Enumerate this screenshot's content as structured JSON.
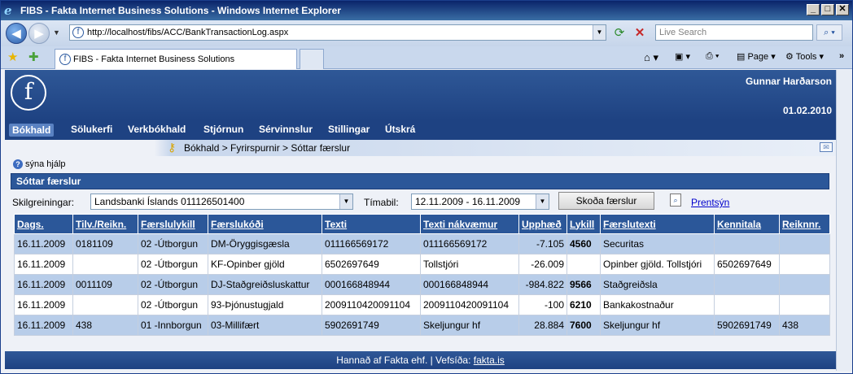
{
  "window": {
    "title": "FIBS - Fakta Internet Business Solutions - Windows Internet Explorer",
    "min_label": "_",
    "max_label": "□",
    "close_label": "✕"
  },
  "address_bar": {
    "url": "http://localhost/fibs/ACC/BankTransactionLog.aspx",
    "search_placeholder": "Live Search"
  },
  "tab": {
    "label": "FIBS - Fakta Internet Business Solutions"
  },
  "toolbar": {
    "page_label": "Page",
    "tools_label": "Tools"
  },
  "header": {
    "logo_letter": "f",
    "user": "Gunnar Harðarson",
    "date": "01.02.2010"
  },
  "menu": {
    "items": [
      {
        "label": "Bókhald"
      },
      {
        "label": "Sölukerfi"
      },
      {
        "label": "Verkbókhald"
      },
      {
        "label": "Stjórnun"
      },
      {
        "label": "Sérvinnslur"
      },
      {
        "label": "Stillingar"
      },
      {
        "label": "Útskrá"
      }
    ]
  },
  "breadcrumb": "Bókhald > Fyrirspurnir > Sóttar færslur",
  "help_label": "sýna hjálp",
  "section_title": "Sóttar færslur",
  "filters": {
    "account_label": "Skilgreiningar:",
    "account_value": "Landsbanki Íslands 011126501400",
    "period_label": "Tímabil:",
    "period_value": "12.11.2009 - 16.11.2009",
    "show_button": "Skoða færslur",
    "print_link": "Prentsýn"
  },
  "table": {
    "columns": [
      "Dags.",
      "Tilv./Reikn.",
      "Færslulykill",
      "Færslukóði",
      "Texti",
      "Texti nákvæmur",
      "Upphæð",
      "Lykill",
      "Færslutexti",
      "Kennitala",
      "Reiknnr."
    ],
    "rows": [
      [
        "16.11.2009",
        "0181109",
        "02 -Útborgun",
        "DM-Öryggisgæsla",
        "011166569172",
        "011166569172",
        "-7.105",
        "4560",
        "Securitas",
        "",
        ""
      ],
      [
        "16.11.2009",
        "",
        "02 -Útborgun",
        "KF-Opinber gjöld",
        "6502697649",
        "Tollstjóri",
        "-26.009",
        "",
        "Opinber gjöld. Tollstjóri",
        "6502697649",
        ""
      ],
      [
        "16.11.2009",
        "0011109",
        "02 -Útborgun",
        "DJ-Staðgreiðsluskattur",
        "000166848944",
        "000166848944",
        "-984.822",
        "9566",
        "Staðgreiðsla",
        "",
        ""
      ],
      [
        "16.11.2009",
        "",
        "02 -Útborgun",
        "93-Þjónustugjald",
        "2009110420091104",
        "2009110420091104",
        "-100",
        "6210",
        "Bankakostnaður",
        "",
        ""
      ],
      [
        "16.11.2009",
        "438",
        "01 -Innborgun",
        "03-Millifært",
        "5902691749",
        "Skeljungur hf",
        "28.884",
        "7600",
        "Skeljungur hf",
        "5902691749",
        "438"
      ]
    ]
  },
  "footer": {
    "text": "Hannað af Fakta ehf. | Vefsíða: ",
    "link": "fakta.is"
  }
}
